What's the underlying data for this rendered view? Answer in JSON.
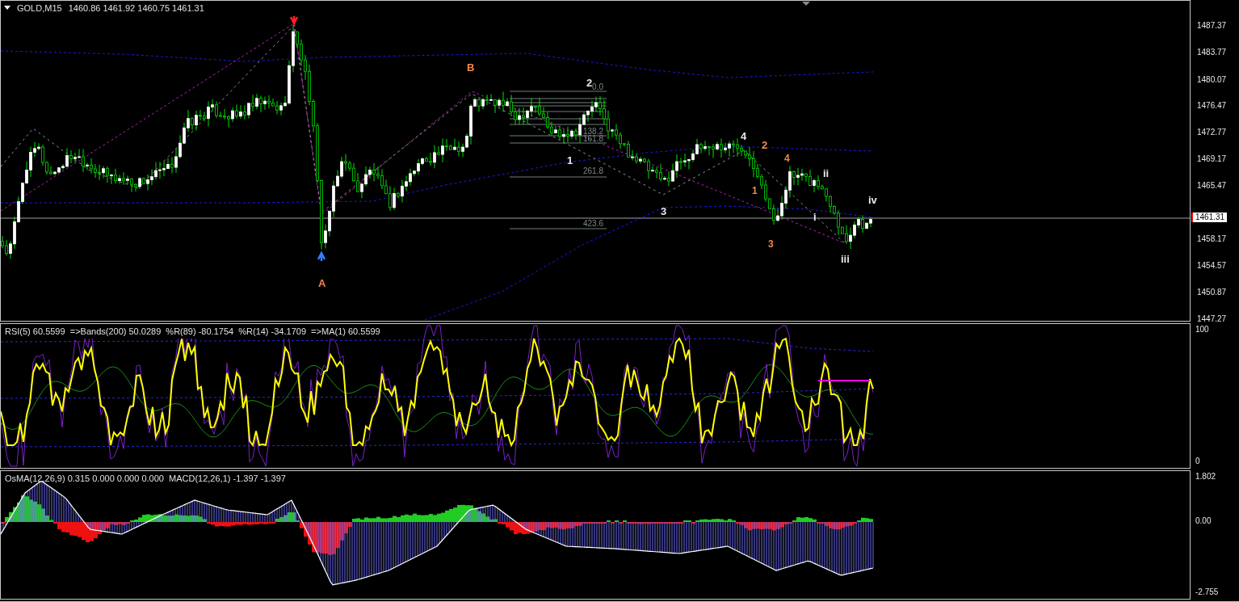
{
  "main_chart": {
    "symbol": "GOLD,M15",
    "ohlc": "1460.86 1461.92 1460.75 1461.31",
    "axis_labels": [
      "1487.37",
      "1483.77",
      "1480.07",
      "1476.47",
      "1472.77",
      "1469.17",
      "1465.47",
      "1458.17",
      "1454.57",
      "1450.87",
      "1447.27"
    ],
    "current_price": "1461.31",
    "fib_levels": [
      "0.0",
      "138.2",
      "161.8",
      "261.8",
      "423.6"
    ],
    "wave_labels": [
      {
        "text": "B",
        "color": "#f08a4b"
      },
      {
        "text": "A",
        "color": "#f08a4b"
      },
      {
        "text": "2",
        "color": "#e8e8f0"
      },
      {
        "text": "1",
        "color": "#e8e8f0"
      },
      {
        "text": "3",
        "color": "#e8e8f0"
      },
      {
        "text": "4",
        "color": "#e8e8f0"
      },
      {
        "text": "2",
        "color": "#f08a4b"
      },
      {
        "text": "1",
        "color": "#f08a4b"
      },
      {
        "text": "4",
        "color": "#f08a4b"
      },
      {
        "text": "3",
        "color": "#f08a4b"
      },
      {
        "text": "ii",
        "color": "#e8e8f0"
      },
      {
        "text": "i",
        "color": "#e8e8f0"
      },
      {
        "text": "iii",
        "color": "#e8e8f0"
      },
      {
        "text": "iv",
        "color": "#e8e8f0"
      }
    ]
  },
  "rsi_panel": {
    "header": "RSI(5) 60.5599  =>Bands(200) 50.0289  %R(89) -80.1754  %R(14) -34.1709  =>MA(1) 60.5599",
    "axis_labels": [
      "100",
      "0"
    ]
  },
  "macd_panel": {
    "header": "OsMA(12,26,9) 0.315 0.000 0.000 0.000  MACD(12,26,1) -1.397 -1.397",
    "axis_labels": [
      "1.802",
      "0.00",
      "-2.755"
    ]
  }
}
